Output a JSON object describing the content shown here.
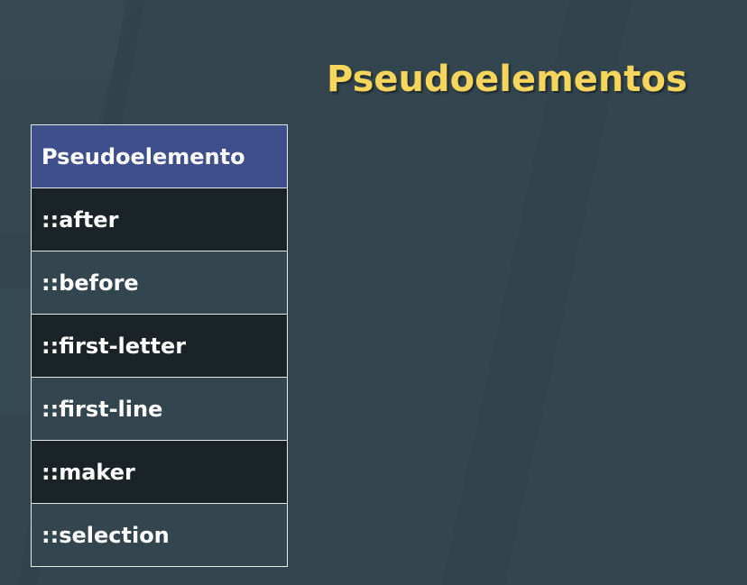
{
  "slide": {
    "title": "Pseudoelementos"
  },
  "table": {
    "header": "Pseudoelemento",
    "rows": [
      "::after",
      "::before",
      "::first-letter",
      "::first-line",
      "::maker",
      "::selection"
    ]
  },
  "colors": {
    "background": "#33464f",
    "title": "#f6d55c",
    "header_bg": "#3e4f8c",
    "row_dark": "#1a2328",
    "row_light": "#33464f",
    "text": "#ffffff"
  }
}
